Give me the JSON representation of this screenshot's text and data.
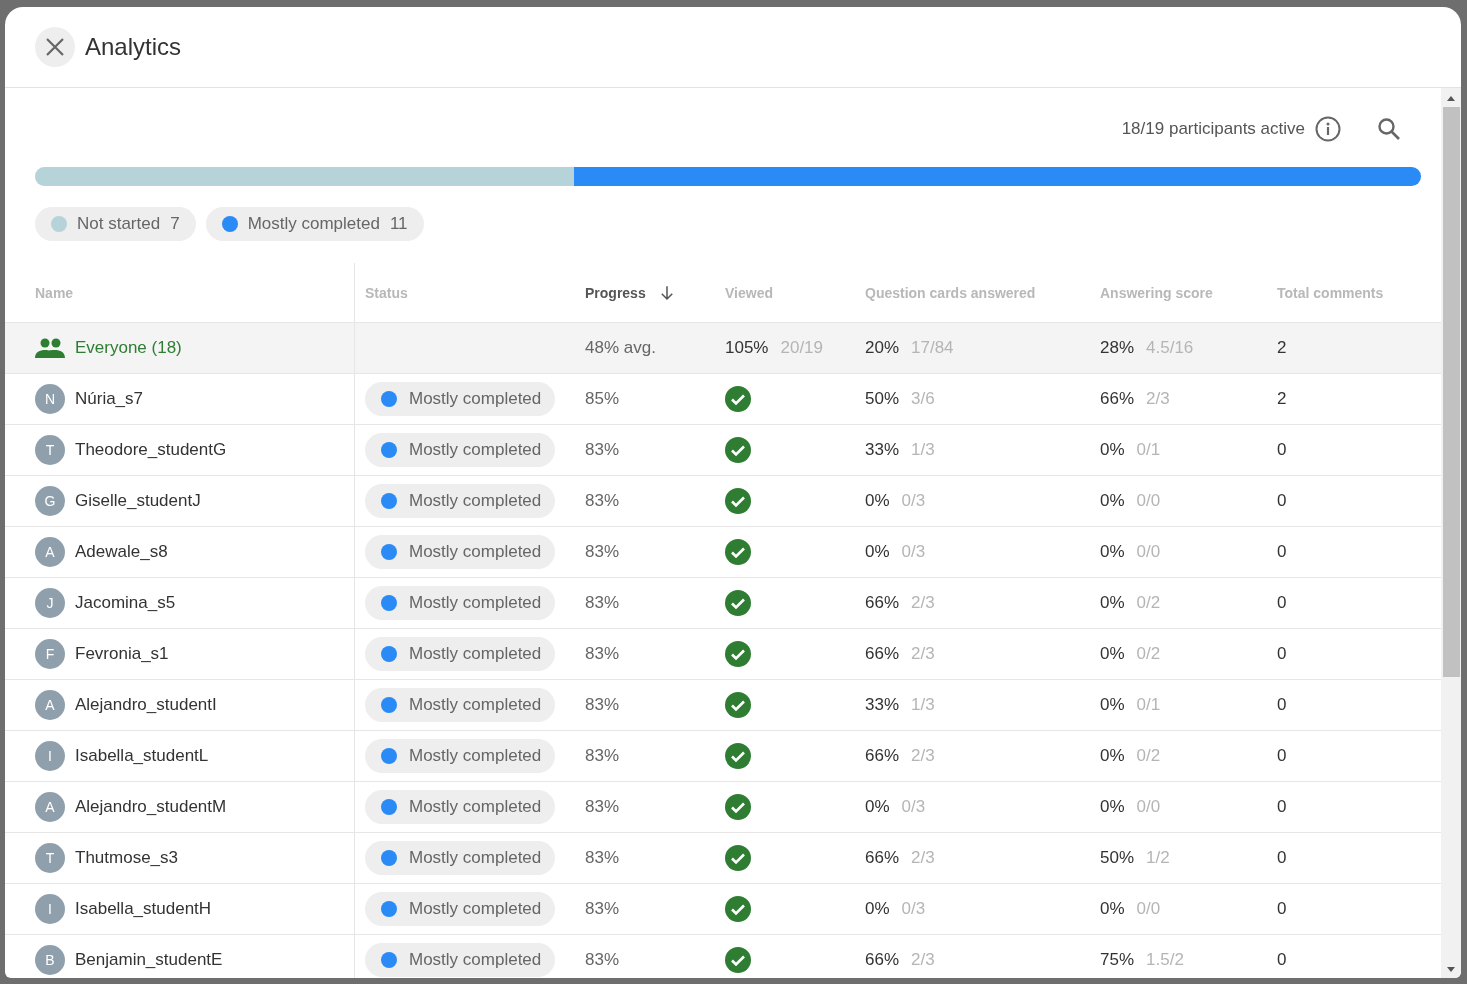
{
  "dialog": {
    "title": "Analytics"
  },
  "summary": {
    "active": "18/19 participants active"
  },
  "progress_bar": [
    {
      "level": 0.389,
      "color": "#b7d3da"
    },
    {
      "level": 0.611,
      "color": "#2a8af6"
    }
  ],
  "legend": [
    {
      "label": "Not started",
      "count": "7",
      "color": "#b7d3da"
    },
    {
      "label": "Mostly completed",
      "count": "11",
      "color": "#2a8af6"
    }
  ],
  "table": {
    "columns": [
      {
        "label": "Name",
        "sorted": false
      },
      {
        "label": "Status",
        "sorted": false
      },
      {
        "label": "Progress",
        "sorted": true
      },
      {
        "label": "Viewed",
        "sorted": false
      },
      {
        "label": "Question cards answered",
        "sorted": false
      },
      {
        "label": "Answering score",
        "sorted": false
      },
      {
        "label": "Total comments",
        "sorted": false
      }
    ],
    "rows": [
      {
        "kind": "group",
        "name": "Everyone (18)",
        "progress": "48% avg.",
        "viewed_pct": "105%",
        "viewed_frac": "20/19",
        "answered_pct": "20%",
        "answered_frac": "17/84",
        "score_pct": "28%",
        "score_frac": "4.5/16",
        "comments": "2"
      },
      {
        "kind": "student",
        "initial": "N",
        "name": "Núria_s7",
        "status": "Mostly completed",
        "color": "#2a8af6",
        "progress": "85%",
        "viewed": true,
        "answered_pct": "50%",
        "answered_frac": "3/6",
        "score_pct": "66%",
        "score_frac": "2/3",
        "comments": "2"
      },
      {
        "kind": "student",
        "initial": "T",
        "name": "Theodore_studentG",
        "status": "Mostly completed",
        "color": "#2a8af6",
        "progress": "83%",
        "viewed": true,
        "answered_pct": "33%",
        "answered_frac": "1/3",
        "score_pct": "0%",
        "score_frac": "0/1",
        "comments": "0"
      },
      {
        "kind": "student",
        "initial": "G",
        "name": "Giselle_studentJ",
        "status": "Mostly completed",
        "color": "#2a8af6",
        "progress": "83%",
        "viewed": true,
        "answered_pct": "0%",
        "answered_frac": "0/3",
        "score_pct": "0%",
        "score_frac": "0/0",
        "comments": "0"
      },
      {
        "kind": "student",
        "initial": "A",
        "name": "Adewale_s8",
        "status": "Mostly completed",
        "color": "#2a8af6",
        "progress": "83%",
        "viewed": true,
        "answered_pct": "0%",
        "answered_frac": "0/3",
        "score_pct": "0%",
        "score_frac": "0/0",
        "comments": "0"
      },
      {
        "kind": "student",
        "initial": "J",
        "name": "Jacomina_s5",
        "status": "Mostly completed",
        "color": "#2a8af6",
        "progress": "83%",
        "viewed": true,
        "answered_pct": "66%",
        "answered_frac": "2/3",
        "score_pct": "0%",
        "score_frac": "0/2",
        "comments": "0"
      },
      {
        "kind": "student",
        "initial": "F",
        "name": "Fevronia_s1",
        "status": "Mostly completed",
        "color": "#2a8af6",
        "progress": "83%",
        "viewed": true,
        "answered_pct": "66%",
        "answered_frac": "2/3",
        "score_pct": "0%",
        "score_frac": "0/2",
        "comments": "0"
      },
      {
        "kind": "student",
        "initial": "A",
        "name": "Alejandro_studentI",
        "status": "Mostly completed",
        "color": "#2a8af6",
        "progress": "83%",
        "viewed": true,
        "answered_pct": "33%",
        "answered_frac": "1/3",
        "score_pct": "0%",
        "score_frac": "0/1",
        "comments": "0"
      },
      {
        "kind": "student",
        "initial": "I",
        "name": "Isabella_studentL",
        "status": "Mostly completed",
        "color": "#2a8af6",
        "progress": "83%",
        "viewed": true,
        "answered_pct": "66%",
        "answered_frac": "2/3",
        "score_pct": "0%",
        "score_frac": "0/2",
        "comments": "0"
      },
      {
        "kind": "student",
        "initial": "A",
        "name": "Alejandro_studentM",
        "status": "Mostly completed",
        "color": "#2a8af6",
        "progress": "83%",
        "viewed": true,
        "answered_pct": "0%",
        "answered_frac": "0/3",
        "score_pct": "0%",
        "score_frac": "0/0",
        "comments": "0"
      },
      {
        "kind": "student",
        "initial": "T",
        "name": "Thutmose_s3",
        "status": "Mostly completed",
        "color": "#2a8af6",
        "progress": "83%",
        "viewed": true,
        "answered_pct": "66%",
        "answered_frac": "2/3",
        "score_pct": "50%",
        "score_frac": "1/2",
        "comments": "0"
      },
      {
        "kind": "student",
        "initial": "I",
        "name": "Isabella_studentH",
        "status": "Mostly completed",
        "color": "#2a8af6",
        "progress": "83%",
        "viewed": true,
        "answered_pct": "0%",
        "answered_frac": "0/3",
        "score_pct": "0%",
        "score_frac": "0/0",
        "comments": "0"
      },
      {
        "kind": "student",
        "initial": "B",
        "name": "Benjamin_studentE",
        "status": "Mostly completed",
        "color": "#2a8af6",
        "progress": "83%",
        "viewed": true,
        "answered_pct": "66%",
        "answered_frac": "2/3",
        "score_pct": "75%",
        "score_frac": "1.5/2",
        "comments": "0"
      }
    ]
  }
}
